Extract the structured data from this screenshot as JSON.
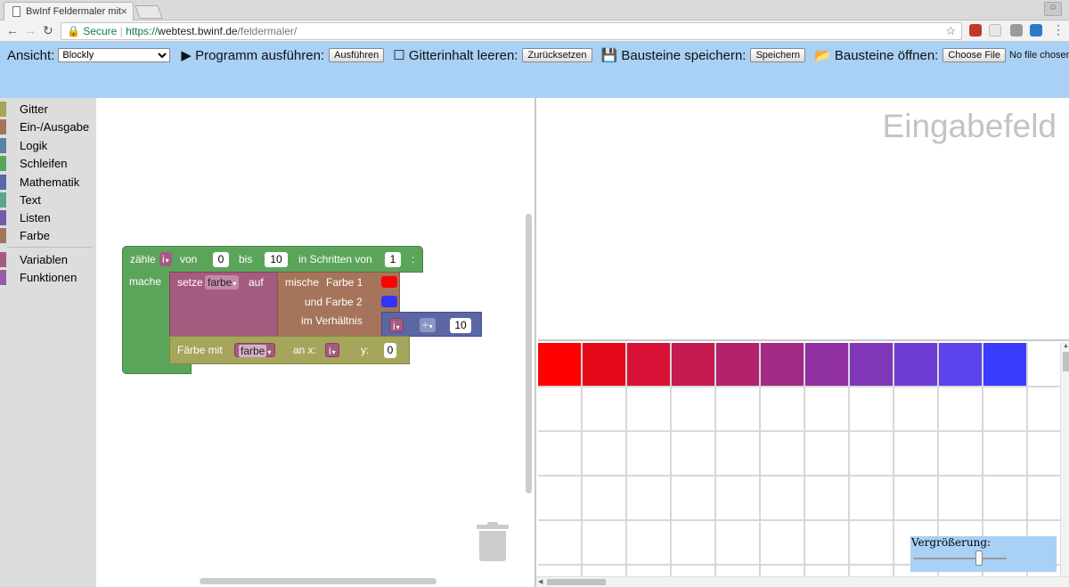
{
  "browser": {
    "tab_title": "BwInf Feldermaler mit",
    "tab_close": "×",
    "secure_label": "Secure",
    "url_scheme": "https://",
    "url_host": "webtest.bwinf.de",
    "url_path": "/feldermaler/"
  },
  "toolbar": {
    "view_label": "Ansicht:",
    "view_value": "Blockly",
    "run_label": "▶ Programm ausführen:",
    "run_button": "Ausführen",
    "clear_label": "☐ Gitterinhalt leeren:",
    "clear_button": "Zurücksetzen",
    "save_label": "💾 Bausteine speichern:",
    "save_button": "Speichern",
    "open_label": "📂 Bausteine öffnen:",
    "open_button": "Choose File",
    "no_file": "No file chosen"
  },
  "toolbox": {
    "categories": [
      {
        "label": "Gitter",
        "color": "#a5a55b"
      },
      {
        "label": "Ein-/Ausgabe",
        "color": "#a5745b"
      },
      {
        "label": "Logik",
        "color": "#5b80a5"
      },
      {
        "label": "Schleifen",
        "color": "#5ba55b"
      },
      {
        "label": "Mathematik",
        "color": "#5b67a5"
      },
      {
        "label": "Text",
        "color": "#5ba58c"
      },
      {
        "label": "Listen",
        "color": "#745ba5"
      },
      {
        "label": "Farbe",
        "color": "#a5745b"
      },
      {
        "label": "Variablen",
        "color": "#a55b80"
      },
      {
        "label": "Funktionen",
        "color": "#995ba5"
      }
    ]
  },
  "blocks": {
    "loop": {
      "count": "zähle",
      "var": "i",
      "from": "von",
      "from_val": "0",
      "to": "bis",
      "to_val": "10",
      "step": "in Schritten von",
      "step_val": "1",
      "colon": ":",
      "do": "mache"
    },
    "set": {
      "label": "setze",
      "var": "farbe",
      "to": "auf"
    },
    "blend": {
      "label": "mische",
      "colour1_label": "Farbe 1",
      "colour1": "#ff0000",
      "colour2_label": "und Farbe 2",
      "colour2": "#3333ff",
      "ratio_label": "im Verhältnis"
    },
    "divide": {
      "var": "i",
      "op": "÷",
      "val": "10"
    },
    "paint": {
      "label": "Färbe mit",
      "var": "farbe",
      "x_label": "an x:",
      "x_var": "i",
      "y_label": "y:",
      "y_val": "0"
    }
  },
  "input_placeholder": "Eingabefeld",
  "grid": {
    "row0_colors": [
      "#ff0000",
      "#e5091a",
      "#d81236",
      "#c51a50",
      "#b3226a",
      "#a22a84",
      "#902f9f",
      "#7f36b8",
      "#6e3dd2",
      "#5b44eb",
      "#3b3bff"
    ]
  },
  "zoom": {
    "label": "Vergrößerung:",
    "level": 0.7
  }
}
